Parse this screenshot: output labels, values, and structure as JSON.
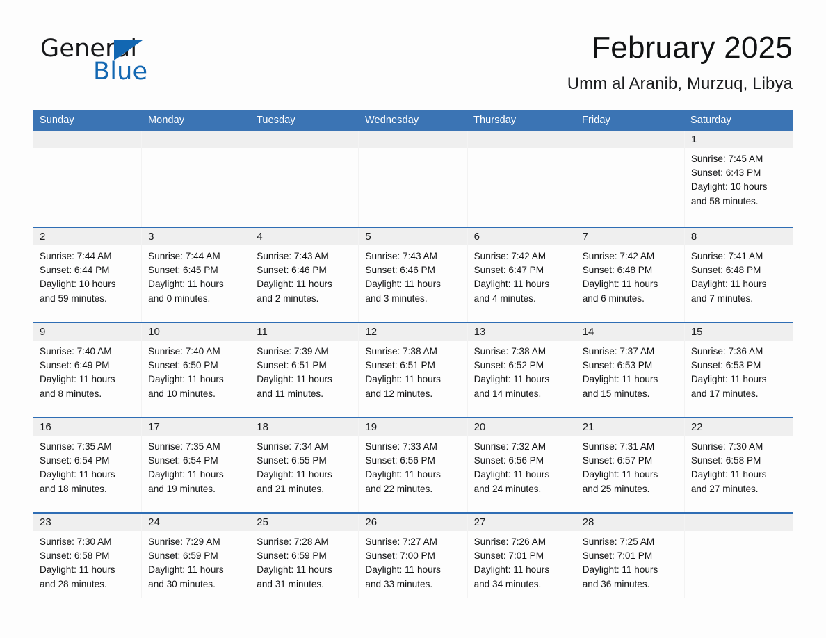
{
  "brand": {
    "word_one": "General",
    "word_two": "Blue",
    "accent_color": "#1267B2",
    "triangle_icon": "brand-triangle-icon"
  },
  "header": {
    "title": "February 2025",
    "subtitle": "Umm al Aranib, Murzuq, Libya"
  },
  "calendar": {
    "header_bg": "#3B74B4",
    "row_divider_color": "#2E6DB4",
    "day_band_bg": "#EFEFEF",
    "weekdays": [
      "Sunday",
      "Monday",
      "Tuesday",
      "Wednesday",
      "Thursday",
      "Friday",
      "Saturday"
    ],
    "weeks": [
      [
        {
          "empty": true
        },
        {
          "empty": true
        },
        {
          "empty": true
        },
        {
          "empty": true
        },
        {
          "empty": true
        },
        {
          "empty": true
        },
        {
          "day": "1",
          "sunrise": "Sunrise: 7:45 AM",
          "sunset": "Sunset: 6:43 PM",
          "daylight_1": "Daylight: 10 hours",
          "daylight_2": "and 58 minutes."
        }
      ],
      [
        {
          "day": "2",
          "sunrise": "Sunrise: 7:44 AM",
          "sunset": "Sunset: 6:44 PM",
          "daylight_1": "Daylight: 10 hours",
          "daylight_2": "and 59 minutes."
        },
        {
          "day": "3",
          "sunrise": "Sunrise: 7:44 AM",
          "sunset": "Sunset: 6:45 PM",
          "daylight_1": "Daylight: 11 hours",
          "daylight_2": "and 0 minutes."
        },
        {
          "day": "4",
          "sunrise": "Sunrise: 7:43 AM",
          "sunset": "Sunset: 6:46 PM",
          "daylight_1": "Daylight: 11 hours",
          "daylight_2": "and 2 minutes."
        },
        {
          "day": "5",
          "sunrise": "Sunrise: 7:43 AM",
          "sunset": "Sunset: 6:46 PM",
          "daylight_1": "Daylight: 11 hours",
          "daylight_2": "and 3 minutes."
        },
        {
          "day": "6",
          "sunrise": "Sunrise: 7:42 AM",
          "sunset": "Sunset: 6:47 PM",
          "daylight_1": "Daylight: 11 hours",
          "daylight_2": "and 4 minutes."
        },
        {
          "day": "7",
          "sunrise": "Sunrise: 7:42 AM",
          "sunset": "Sunset: 6:48 PM",
          "daylight_1": "Daylight: 11 hours",
          "daylight_2": "and 6 minutes."
        },
        {
          "day": "8",
          "sunrise": "Sunrise: 7:41 AM",
          "sunset": "Sunset: 6:48 PM",
          "daylight_1": "Daylight: 11 hours",
          "daylight_2": "and 7 minutes."
        }
      ],
      [
        {
          "day": "9",
          "sunrise": "Sunrise: 7:40 AM",
          "sunset": "Sunset: 6:49 PM",
          "daylight_1": "Daylight: 11 hours",
          "daylight_2": "and 8 minutes."
        },
        {
          "day": "10",
          "sunrise": "Sunrise: 7:40 AM",
          "sunset": "Sunset: 6:50 PM",
          "daylight_1": "Daylight: 11 hours",
          "daylight_2": "and 10 minutes."
        },
        {
          "day": "11",
          "sunrise": "Sunrise: 7:39 AM",
          "sunset": "Sunset: 6:51 PM",
          "daylight_1": "Daylight: 11 hours",
          "daylight_2": "and 11 minutes."
        },
        {
          "day": "12",
          "sunrise": "Sunrise: 7:38 AM",
          "sunset": "Sunset: 6:51 PM",
          "daylight_1": "Daylight: 11 hours",
          "daylight_2": "and 12 minutes."
        },
        {
          "day": "13",
          "sunrise": "Sunrise: 7:38 AM",
          "sunset": "Sunset: 6:52 PM",
          "daylight_1": "Daylight: 11 hours",
          "daylight_2": "and 14 minutes."
        },
        {
          "day": "14",
          "sunrise": "Sunrise: 7:37 AM",
          "sunset": "Sunset: 6:53 PM",
          "daylight_1": "Daylight: 11 hours",
          "daylight_2": "and 15 minutes."
        },
        {
          "day": "15",
          "sunrise": "Sunrise: 7:36 AM",
          "sunset": "Sunset: 6:53 PM",
          "daylight_1": "Daylight: 11 hours",
          "daylight_2": "and 17 minutes."
        }
      ],
      [
        {
          "day": "16",
          "sunrise": "Sunrise: 7:35 AM",
          "sunset": "Sunset: 6:54 PM",
          "daylight_1": "Daylight: 11 hours",
          "daylight_2": "and 18 minutes."
        },
        {
          "day": "17",
          "sunrise": "Sunrise: 7:35 AM",
          "sunset": "Sunset: 6:54 PM",
          "daylight_1": "Daylight: 11 hours",
          "daylight_2": "and 19 minutes."
        },
        {
          "day": "18",
          "sunrise": "Sunrise: 7:34 AM",
          "sunset": "Sunset: 6:55 PM",
          "daylight_1": "Daylight: 11 hours",
          "daylight_2": "and 21 minutes."
        },
        {
          "day": "19",
          "sunrise": "Sunrise: 7:33 AM",
          "sunset": "Sunset: 6:56 PM",
          "daylight_1": "Daylight: 11 hours",
          "daylight_2": "and 22 minutes."
        },
        {
          "day": "20",
          "sunrise": "Sunrise: 7:32 AM",
          "sunset": "Sunset: 6:56 PM",
          "daylight_1": "Daylight: 11 hours",
          "daylight_2": "and 24 minutes."
        },
        {
          "day": "21",
          "sunrise": "Sunrise: 7:31 AM",
          "sunset": "Sunset: 6:57 PM",
          "daylight_1": "Daylight: 11 hours",
          "daylight_2": "and 25 minutes."
        },
        {
          "day": "22",
          "sunrise": "Sunrise: 7:30 AM",
          "sunset": "Sunset: 6:58 PM",
          "daylight_1": "Daylight: 11 hours",
          "daylight_2": "and 27 minutes."
        }
      ],
      [
        {
          "day": "23",
          "sunrise": "Sunrise: 7:30 AM",
          "sunset": "Sunset: 6:58 PM",
          "daylight_1": "Daylight: 11 hours",
          "daylight_2": "and 28 minutes."
        },
        {
          "day": "24",
          "sunrise": "Sunrise: 7:29 AM",
          "sunset": "Sunset: 6:59 PM",
          "daylight_1": "Daylight: 11 hours",
          "daylight_2": "and 30 minutes."
        },
        {
          "day": "25",
          "sunrise": "Sunrise: 7:28 AM",
          "sunset": "Sunset: 6:59 PM",
          "daylight_1": "Daylight: 11 hours",
          "daylight_2": "and 31 minutes."
        },
        {
          "day": "26",
          "sunrise": "Sunrise: 7:27 AM",
          "sunset": "Sunset: 7:00 PM",
          "daylight_1": "Daylight: 11 hours",
          "daylight_2": "and 33 minutes."
        },
        {
          "day": "27",
          "sunrise": "Sunrise: 7:26 AM",
          "sunset": "Sunset: 7:01 PM",
          "daylight_1": "Daylight: 11 hours",
          "daylight_2": "and 34 minutes."
        },
        {
          "day": "28",
          "sunrise": "Sunrise: 7:25 AM",
          "sunset": "Sunset: 7:01 PM",
          "daylight_1": "Daylight: 11 hours",
          "daylight_2": "and 36 minutes."
        },
        {
          "empty": true
        }
      ]
    ]
  }
}
